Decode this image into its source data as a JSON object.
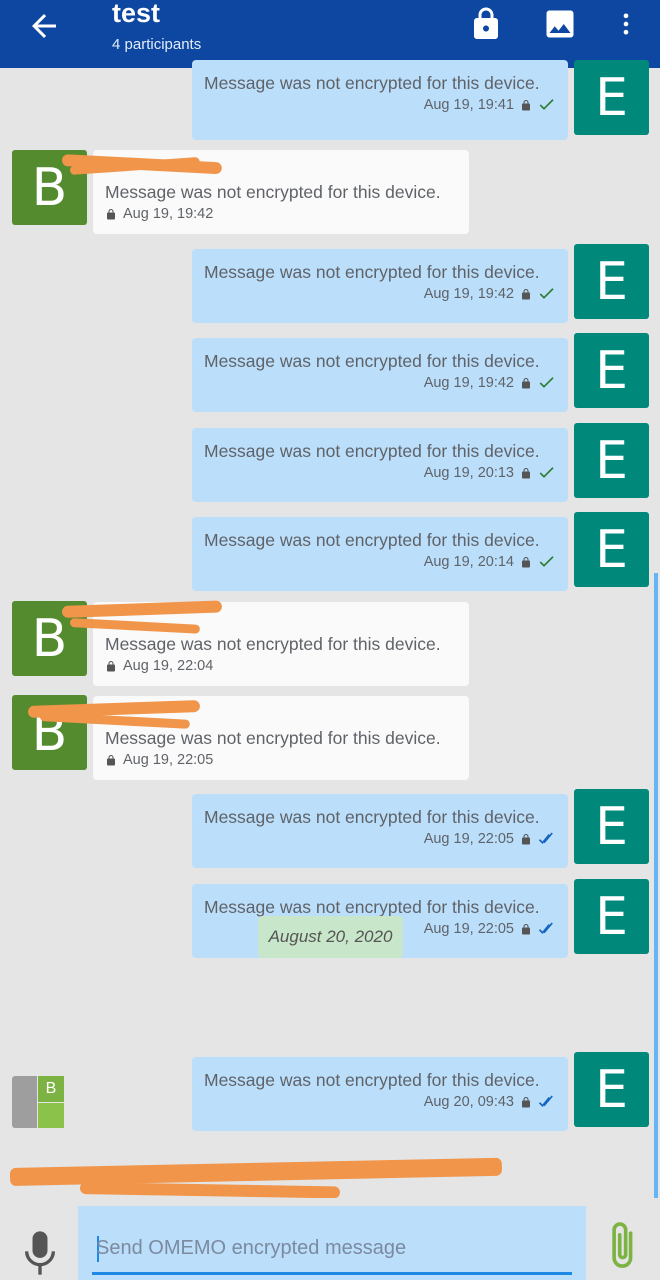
{
  "header": {
    "title": "test",
    "subtitle": "4 participants",
    "back_icon": "arrow-left-icon",
    "actions": [
      "lock-icon",
      "image-icon",
      "more-vert-icon"
    ]
  },
  "messages": [
    {
      "dir": "out",
      "text": "Message was not encrypted for this device.",
      "time": "Aug 19, 19:41",
      "avatar": "E",
      "status": "sent"
    },
    {
      "dir": "in",
      "text": "Message was not encrypted for this device.",
      "time": "Aug 19, 19:42",
      "avatar": "B",
      "status": ""
    },
    {
      "dir": "out",
      "text": "Message was not encrypted for this device.",
      "time": "Aug 19, 19:42",
      "avatar": "E",
      "status": "sent"
    },
    {
      "dir": "out",
      "text": "Message was not encrypted for this device.",
      "time": "Aug 19, 19:42",
      "avatar": "E",
      "status": "sent"
    },
    {
      "dir": "out",
      "text": "Message was not encrypted for this device.",
      "time": "Aug 19, 20:13",
      "avatar": "E",
      "status": "sent"
    },
    {
      "dir": "out",
      "text": "Message was not encrypted for this device.",
      "time": "Aug 19, 20:14",
      "avatar": "E",
      "status": "sent"
    },
    {
      "dir": "in",
      "text": "Message was not encrypted for this device.",
      "time": "Aug 19, 22:04",
      "avatar": "B",
      "status": ""
    },
    {
      "dir": "in",
      "text": "Message was not encrypted for this device.",
      "time": "Aug 19, 22:05",
      "avatar": "B",
      "status": ""
    },
    {
      "dir": "out",
      "text": "Message was not encrypted for this device.",
      "time": "Aug 19, 22:05",
      "avatar": "E",
      "status": "read"
    },
    {
      "dir": "out",
      "text": "Message was not encrypted for this device.",
      "time": "Aug 19, 22:05",
      "avatar": "E",
      "status": "read"
    },
    {
      "dir": "out",
      "text": "Message was not encrypted for this device.",
      "time": "Aug 20, 09:43",
      "avatar": "E",
      "status": "read"
    }
  ],
  "date_separator": "August 20, 2020",
  "read_marker": {
    "avatar_letter": "B"
  },
  "compose": {
    "placeholder": "Send OMEMO encrypted message",
    "mic_icon": "microphone-icon",
    "attach_icon": "paperclip-icon"
  },
  "colors": {
    "app_bar": "#0d47a1",
    "outgoing_bubble": "#bbdefb",
    "incoming_bubble": "#fafafa",
    "avatar_e": "#00897b",
    "avatar_b": "#558b2f",
    "sent_check": "#2e7d32",
    "read_check": "#1565c0",
    "date_pill": "#c8e6c9",
    "redaction": "#f0954a"
  }
}
